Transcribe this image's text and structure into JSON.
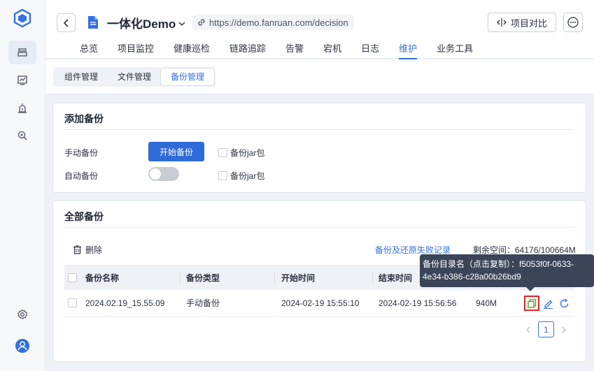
{
  "rail": {
    "icons": [
      "logo-cube-icon",
      "layers-icon",
      "monitor-chart-icon",
      "alarm-icon",
      "search-gear-icon",
      "settings-gear-icon",
      "user-avatar-icon"
    ]
  },
  "header": {
    "project_title": "一体化Demo",
    "url": "https://demo.fanruan.com/decision",
    "compare_label": "项目对比",
    "tabs": [
      {
        "label": "总览",
        "active": false
      },
      {
        "label": "项目监控",
        "active": false
      },
      {
        "label": "健康巡检",
        "active": false
      },
      {
        "label": "链路追踪",
        "active": false
      },
      {
        "label": "告警",
        "active": false
      },
      {
        "label": "宕机",
        "active": false
      },
      {
        "label": "日志",
        "active": false
      },
      {
        "label": "维护",
        "active": true
      },
      {
        "label": "业务工具",
        "active": false
      }
    ]
  },
  "subtabs": [
    {
      "label": "组件管理",
      "active": false
    },
    {
      "label": "文件管理",
      "active": false
    },
    {
      "label": "备份管理",
      "active": true
    }
  ],
  "add_backup": {
    "title": "添加备份",
    "manual_label": "手动备份",
    "start_button": "开始备份",
    "jar_label_1": "备份jar包",
    "auto_label": "自动备份",
    "jar_label_2": "备份jar包",
    "auto_enabled": false
  },
  "all_backups": {
    "title": "全部备份",
    "delete_label": "删除",
    "fail_link": "备份及还原失败记录",
    "space_label": "剩余空间：64176/100664M",
    "columns": [
      "备份名称",
      "备份类型",
      "开始时间",
      "结束时间"
    ],
    "rows": [
      {
        "name": "2024.02.19_15.55.09",
        "type": "手动备份",
        "start": "2024-02-19 15:55:10",
        "end": "2024-02-19 15:56:56",
        "size": "940M"
      }
    ],
    "page": "1"
  },
  "tooltip": {
    "line1": "备份目录名（点击复制）：f5053f0f-0633-",
    "line2": "4e34-b386-c28a00b26bd9"
  },
  "colors": {
    "accent": "#3370e6",
    "primary_button": "#2f6bd9",
    "highlight_outline": "#e0262b",
    "tooltip_bg": "#3c4558"
  }
}
